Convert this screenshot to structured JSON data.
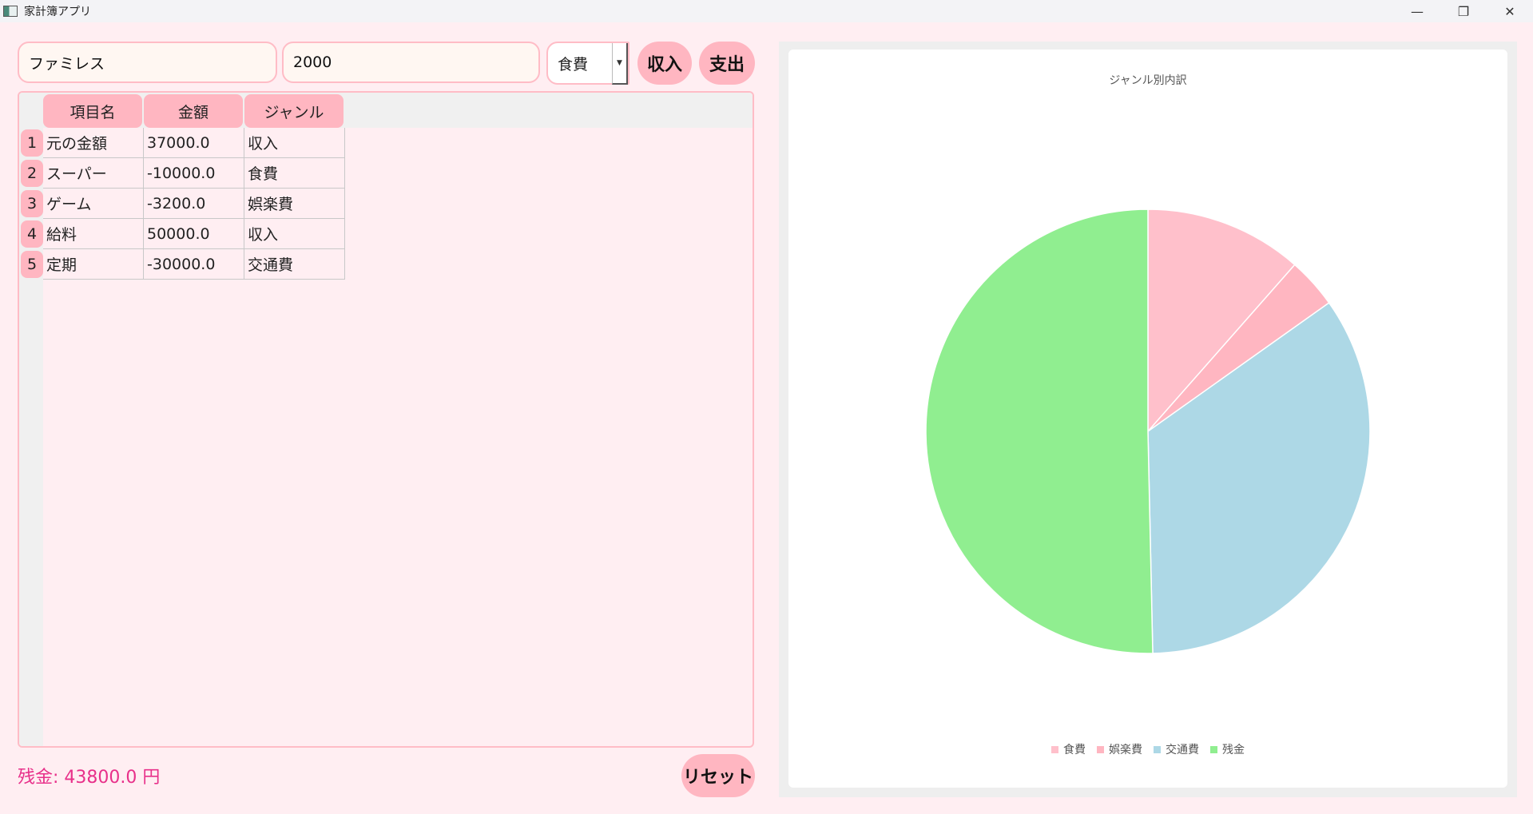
{
  "window": {
    "title": "家計簿アプリ",
    "controls": {
      "minimize": "—",
      "restore": "❐",
      "close": "✕"
    }
  },
  "form": {
    "name_value": "ファミレス",
    "amount_value": "2000",
    "genre_selected": "食費",
    "income_label": "収入",
    "expense_label": "支出"
  },
  "table": {
    "headers": [
      "項目名",
      "金額",
      "ジャンル"
    ],
    "rows": [
      {
        "num": "1",
        "name": "元の金額",
        "amount": "37000.0",
        "genre": "収入"
      },
      {
        "num": "2",
        "name": "スーパー",
        "amount": "-10000.0",
        "genre": "食費"
      },
      {
        "num": "3",
        "name": "ゲーム",
        "amount": "-3200.0",
        "genre": "娯楽費"
      },
      {
        "num": "4",
        "name": "給料",
        "amount": "50000.0",
        "genre": "収入"
      },
      {
        "num": "5",
        "name": "定期",
        "amount": "-30000.0",
        "genre": "交通費"
      }
    ]
  },
  "footer": {
    "balance_text": "残金: 43800.0 円",
    "reset_label": "リセット"
  },
  "colors": {
    "accent_pink": "#ffb6c1",
    "balance_text": "#e8308a",
    "food": "#ffc0cb",
    "entertainment": "#ffb6c1",
    "transport": "#add8e6",
    "remaining": "#90ee90"
  },
  "chart_data": {
    "type": "pie",
    "title": "ジャンル別内訳",
    "categories": [
      "食費",
      "娯楽費",
      "交通費",
      "残金"
    ],
    "values": [
      10000,
      3200,
      30000,
      43800
    ],
    "colors": [
      "#ffc0cb",
      "#ffb6c1",
      "#add8e6",
      "#90ee90"
    ],
    "legend_position": "bottom"
  }
}
